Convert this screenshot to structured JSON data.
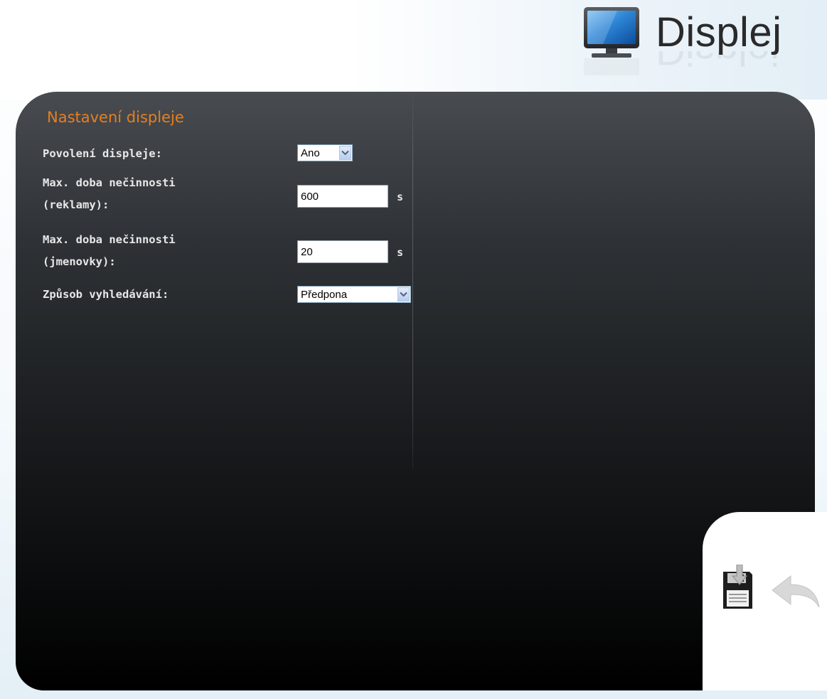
{
  "header": {
    "title": "Displej",
    "icon": "monitor-icon"
  },
  "section": {
    "title": "Nastavení displeje"
  },
  "form": {
    "display_enabled": {
      "label": "Povolení displeje:",
      "value": "Ano"
    },
    "idle_ads": {
      "label_line1": "Max. doba nečinnosti",
      "label_line2": "(reklamy):",
      "value": "600",
      "unit": "s"
    },
    "idle_names": {
      "label_line1": "Max. doba nečinnosti",
      "label_line2": "(jmenovky):",
      "value": "20",
      "unit": "s"
    },
    "search_mode": {
      "label": "Způsob vyhledávání:",
      "value": "Předpona"
    }
  },
  "toolbar": {
    "save_icon": "floppy-save-icon",
    "back_icon": "back-arrow-icon"
  },
  "colors": {
    "section_title": "#e87e1f",
    "label_text": "#e8e8e8",
    "panel_top": "#484c51",
    "panel_bottom": "#000000"
  }
}
